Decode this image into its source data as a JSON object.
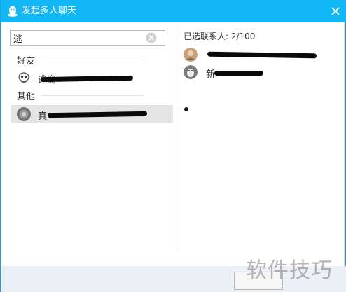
{
  "window": {
    "title": "发起多人聊天",
    "accent_color": "#12b7f5"
  },
  "search": {
    "value": "逃",
    "placeholder": ""
  },
  "groups": [
    {
      "label": "好友",
      "contacts": [
        {
          "name": "逃离",
          "selected": false,
          "avatar_icon": "cartoon-avatar-icon"
        }
      ]
    },
    {
      "label": "其他",
      "contacts": [
        {
          "name": "真",
          "selected": true,
          "avatar_icon": "gray-avatar-icon"
        }
      ]
    }
  ],
  "selected_panel": {
    "count_label": "已选联系人: 2/100",
    "items": [
      {
        "name": "",
        "avatar_icon": "photo-avatar-icon"
      },
      {
        "name": "新",
        "avatar_icon": "penguin-avatar-icon"
      }
    ]
  },
  "watermark": "软件技巧"
}
